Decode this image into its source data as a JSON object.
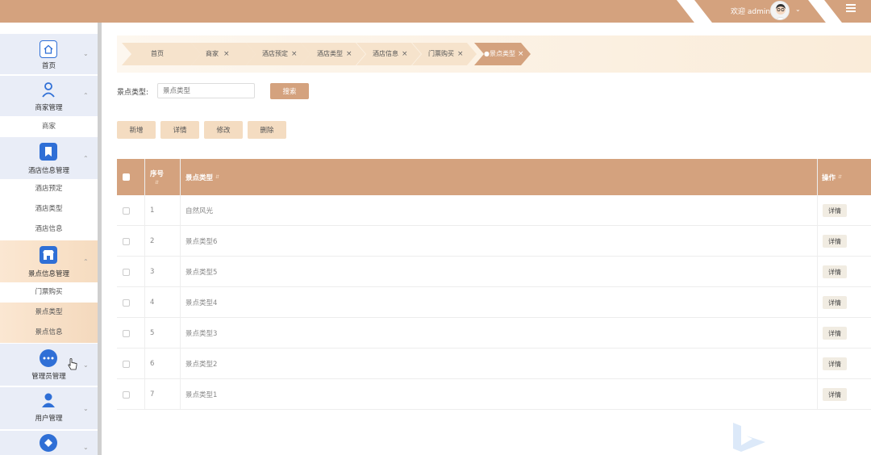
{
  "header": {
    "welcome": "欢迎 admin"
  },
  "sidebar": {
    "groups": [
      {
        "label": "首页",
        "icon": "home-icon"
      },
      {
        "label": "商家管理",
        "icon": "person-icon",
        "items": [
          "商家"
        ]
      },
      {
        "label": "酒店信息管理",
        "icon": "bookmark-icon",
        "items": [
          "酒店预定",
          "酒店类型",
          "酒店信息"
        ]
      },
      {
        "label": "景点信息管理",
        "icon": "store-icon",
        "items": [
          "门票购买",
          "景点类型",
          "景点信息"
        ]
      },
      {
        "label": "管理员管理",
        "icon": "dots-icon"
      },
      {
        "label": "用户管理",
        "icon": "user-icon"
      }
    ]
  },
  "tabs": [
    "首页",
    "商家",
    "酒店预定",
    "酒店类型",
    "酒店信息",
    "门票购买",
    "●景点类型"
  ],
  "search": {
    "label": "景点类型:",
    "placeholder": "景点类型",
    "button": "搜索"
  },
  "actions": {
    "add": "新增",
    "detail": "详情",
    "edit": "修改",
    "delete": "删除"
  },
  "table": {
    "headers": {
      "index": "序号",
      "type": "景点类型",
      "ops": "操作"
    },
    "rows": [
      {
        "index": "1",
        "type": "自然风光",
        "op": "详情"
      },
      {
        "index": "2",
        "type": "景点类型6",
        "op": "详情"
      },
      {
        "index": "3",
        "type": "景点类型5",
        "op": "详情"
      },
      {
        "index": "4",
        "type": "景点类型4",
        "op": "详情"
      },
      {
        "index": "5",
        "type": "景点类型3",
        "op": "详情"
      },
      {
        "index": "6",
        "type": "景点类型2",
        "op": "详情"
      },
      {
        "index": "7",
        "type": "景点类型1",
        "op": "详情"
      }
    ]
  },
  "colors": {
    "accent": "#d4a27e",
    "light_accent": "#f4dcc1",
    "icon_blue": "#2f6fd6",
    "sidebar_bg": "#e9edf7"
  }
}
